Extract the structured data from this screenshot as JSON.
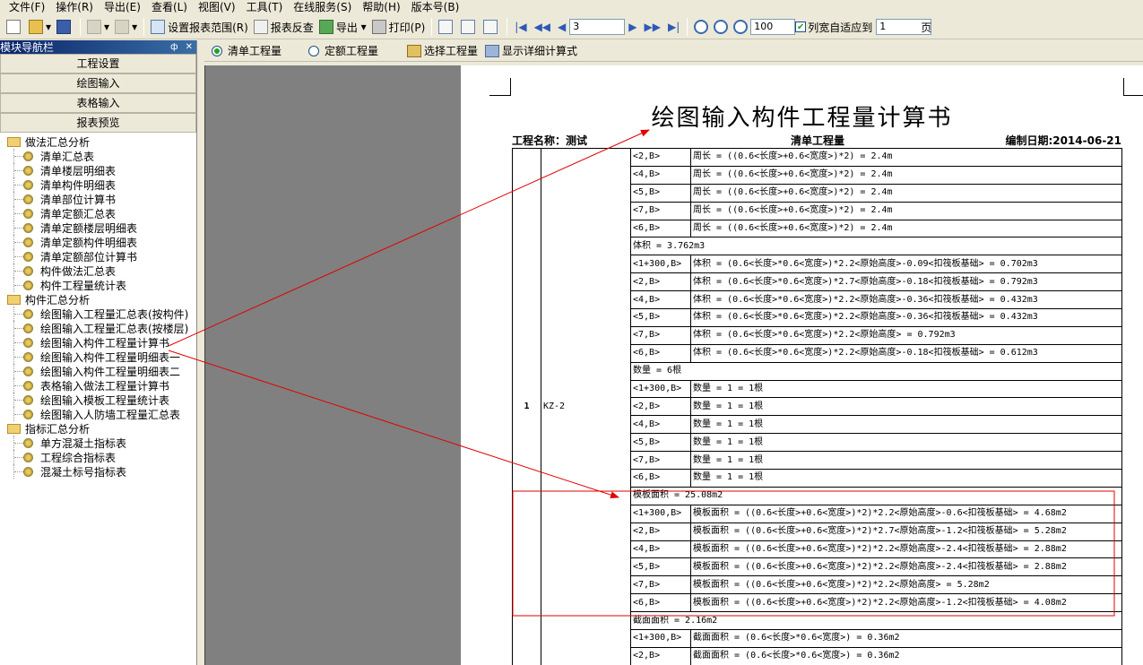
{
  "menu": [
    "文件(F)",
    "操作(R)",
    "导出(E)",
    "查看(L)",
    "视图(V)",
    "工具(T)",
    "在线服务(S)",
    "帮助(H)",
    "版本号(B)"
  ],
  "toolbar": {
    "set_range": "设置报表范围(R)",
    "reverse_check": "报表反查",
    "export": "导出",
    "print": "打印(P)",
    "page_value": "3",
    "zoom_value": "100",
    "fit_label": "列宽自适应到",
    "fit_value": "1",
    "page_unit": "页"
  },
  "left_panel": {
    "title": "模块导航栏",
    "pin": "ф",
    "close": "✕",
    "nav_buttons": [
      "工程设置",
      "绘图输入",
      "表格输入",
      "报表预览"
    ],
    "tree": [
      {
        "type": "folder",
        "label": "做法汇总分析"
      },
      {
        "type": "leaf",
        "label": "清单汇总表"
      },
      {
        "type": "leaf",
        "label": "清单楼层明细表"
      },
      {
        "type": "leaf",
        "label": "清单构件明细表"
      },
      {
        "type": "leaf",
        "label": "清单部位计算书"
      },
      {
        "type": "leaf",
        "label": "清单定额汇总表"
      },
      {
        "type": "leaf",
        "label": "清单定额楼层明细表"
      },
      {
        "type": "leaf",
        "label": "清单定额构件明细表"
      },
      {
        "type": "leaf",
        "label": "清单定额部位计算书"
      },
      {
        "type": "leaf",
        "label": "构件做法汇总表"
      },
      {
        "type": "leaf",
        "label": "构件工程量统计表"
      },
      {
        "type": "folder",
        "label": "构件汇总分析"
      },
      {
        "type": "leaf",
        "label": "绘图输入工程量汇总表(按构件)"
      },
      {
        "type": "leaf",
        "label": "绘图输入工程量汇总表(按楼层)"
      },
      {
        "type": "leaf",
        "label": "绘图输入构件工程量计算书"
      },
      {
        "type": "leaf",
        "label": "绘图输入构件工程量明细表一"
      },
      {
        "type": "leaf",
        "label": "绘图输入构件工程量明细表二"
      },
      {
        "type": "leaf",
        "label": "表格输入做法工程量计算书"
      },
      {
        "type": "leaf",
        "label": "绘图输入模板工程量统计表"
      },
      {
        "type": "leaf",
        "label": "绘图输入人防墙工程量汇总表"
      },
      {
        "type": "folder",
        "label": "指标汇总分析"
      },
      {
        "type": "leaf",
        "label": "单方混凝土指标表"
      },
      {
        "type": "leaf",
        "label": "工程综合指标表"
      },
      {
        "type": "leaf",
        "label": "混凝土标号指标表"
      }
    ]
  },
  "options": {
    "radio1": "清单工程量",
    "radio2": "定额工程量",
    "select_qty": "选择工程量",
    "show_detail": "显示详细计算式"
  },
  "report": {
    "title": "绘图输入构件工程量计算书",
    "project_label": "工程名称：测试",
    "mode_label": "清单工程量",
    "date_label": "编制日期:2014-06-21",
    "item_no": "1",
    "item_code": "KZ-2",
    "rows": [
      {
        "loc": "<2,B>",
        "formula": "周长 = ((0.6<长度>+0.6<宽度>)*2) = 2.4m"
      },
      {
        "loc": "<4,B>",
        "formula": "周长 = ((0.6<长度>+0.6<宽度>)*2) = 2.4m"
      },
      {
        "loc": "<5,B>",
        "formula": "周长 = ((0.6<长度>+0.6<宽度>)*2) = 2.4m"
      },
      {
        "loc": "<7,B>",
        "formula": "周长 = ((0.6<长度>+0.6<宽度>)*2) = 2.4m"
      },
      {
        "loc": "<6,B>",
        "formula": "周长 = ((0.6<长度>+0.6<宽度>)*2) = 2.4m"
      },
      {
        "summary": "体积 = 3.762m3"
      },
      {
        "loc": "<1+300,B>",
        "formula": "体积 = (0.6<长度>*0.6<宽度>)*2.2<原始高度>-0.09<扣筏板基础> = 0.702m3"
      },
      {
        "loc": "<2,B>",
        "formula": "体积 = (0.6<长度>*0.6<宽度>)*2.7<原始高度>-0.18<扣筏板基础> = 0.792m3"
      },
      {
        "loc": "<4,B>",
        "formula": "体积 = (0.6<长度>*0.6<宽度>)*2.2<原始高度>-0.36<扣筏板基础> = 0.432m3"
      },
      {
        "loc": "<5,B>",
        "formula": "体积 = (0.6<长度>*0.6<宽度>)*2.2<原始高度>-0.36<扣筏板基础> = 0.432m3"
      },
      {
        "loc": "<7,B>",
        "formula": "体积 = (0.6<长度>*0.6<宽度>)*2.2<原始高度> = 0.792m3"
      },
      {
        "loc": "<6,B>",
        "formula": "体积 = (0.6<长度>*0.6<宽度>)*2.2<原始高度>-0.18<扣筏板基础> = 0.612m3"
      },
      {
        "summary": "数量 = 6根"
      },
      {
        "loc": "<1+300,B>",
        "formula": "数量 = 1 = 1根"
      },
      {
        "loc": "<2,B>",
        "formula": "数量 = 1 = 1根"
      },
      {
        "loc": "<4,B>",
        "formula": "数量 = 1 = 1根"
      },
      {
        "loc": "<5,B>",
        "formula": "数量 = 1 = 1根"
      },
      {
        "loc": "<7,B>",
        "formula": "数量 = 1 = 1根"
      },
      {
        "loc": "<6,B>",
        "formula": "数量 = 1 = 1根"
      },
      {
        "summary": "模板面积 = 25.08m2"
      },
      {
        "loc": "<1+300,B>",
        "formula": "模板面积 = ((0.6<长度>+0.6<宽度>)*2)*2.2<原始高度>-0.6<扣筏板基础> = 4.68m2"
      },
      {
        "loc": "<2,B>",
        "formula": "模板面积 = ((0.6<长度>+0.6<宽度>)*2)*2.7<原始高度>-1.2<扣筏板基础> = 5.28m2"
      },
      {
        "loc": "<4,B>",
        "formula": "模板面积 = ((0.6<长度>+0.6<宽度>)*2)*2.2<原始高度>-2.4<扣筏板基础> = 2.88m2"
      },
      {
        "loc": "<5,B>",
        "formula": "模板面积 = ((0.6<长度>+0.6<宽度>)*2)*2.2<原始高度>-2.4<扣筏板基础> = 2.88m2"
      },
      {
        "loc": "<7,B>",
        "formula": "模板面积 = ((0.6<长度>+0.6<宽度>)*2)*2.2<原始高度> = 5.28m2"
      },
      {
        "loc": "<6,B>",
        "formula": "模板面积 = ((0.6<长度>+0.6<宽度>)*2)*2.2<原始高度>-1.2<扣筏板基础> = 4.08m2"
      },
      {
        "summary": "截面面积 = 2.16m2"
      },
      {
        "loc": "<1+300,B>",
        "formula": "截面面积 = (0.6<长度>*0.6<宽度>) = 0.36m2"
      },
      {
        "loc": "<2,B>",
        "formula": "截面面积 = (0.6<长度>*0.6<宽度>) = 0.36m2"
      }
    ]
  },
  "colors": {
    "annotation": "#e00000",
    "panel_title": "#0a246a"
  }
}
